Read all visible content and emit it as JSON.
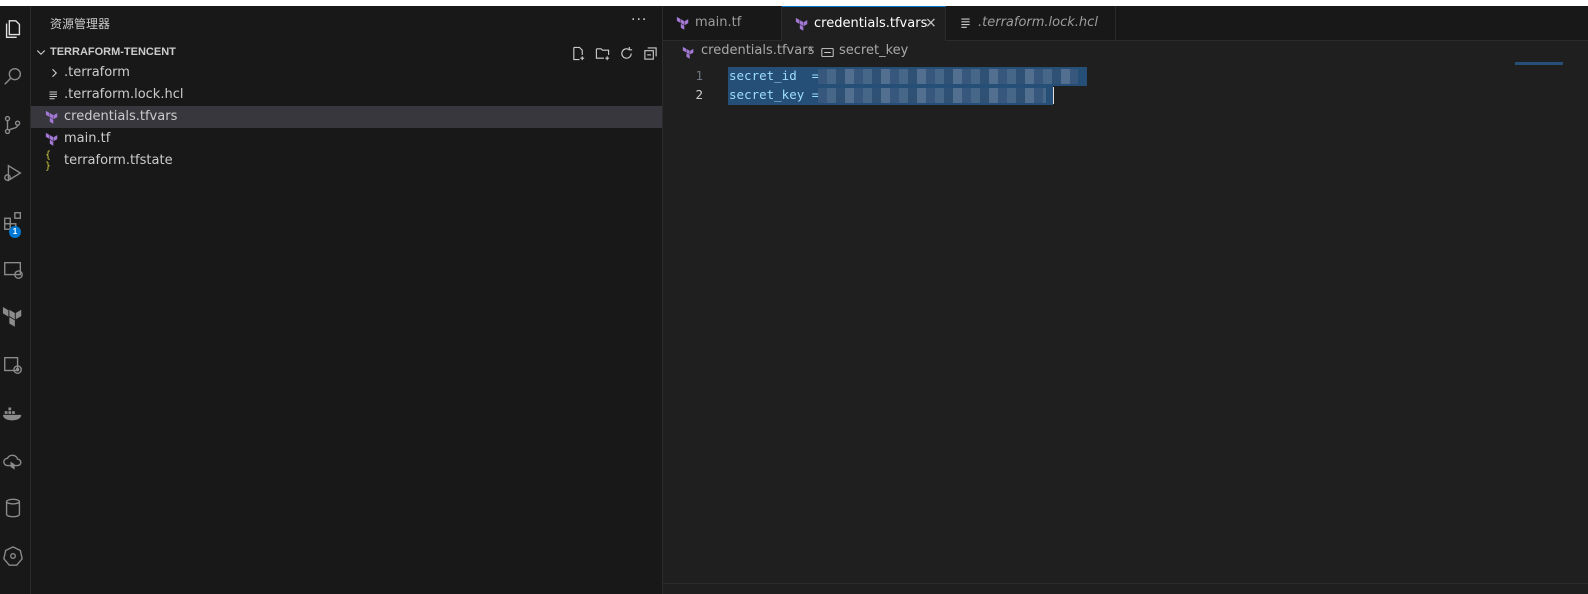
{
  "explorer": {
    "title": "资源管理器",
    "more_label": "···",
    "section_title": "TERRAFORM-TENCENT",
    "tree": [
      {
        "label": ".terraform",
        "icon": "chevron-right-icon"
      },
      {
        "label": ".terraform.lock.hcl",
        "icon": "lines-file-icon"
      },
      {
        "label": "credentials.tfvars",
        "icon": "terraform-icon"
      },
      {
        "label": "main.tf",
        "icon": "terraform-icon"
      },
      {
        "label": "terraform.tfstate",
        "icon": "json-braces-icon"
      }
    ],
    "json_icon_glyph": "{ }"
  },
  "activity": {
    "extensions_badge": "1"
  },
  "tabs": [
    {
      "label": "main.tf",
      "icon": "terraform-icon"
    },
    {
      "label": "credentials.tfvars",
      "icon": "terraform-icon",
      "close": "×"
    },
    {
      "label": ".terraform.lock.hcl",
      "icon": "lines-file-icon"
    }
  ],
  "breadcrumb": {
    "file": "credentials.tfvars",
    "separator": "›",
    "symbol": "secret_key"
  },
  "editor": {
    "lines": [
      {
        "number": "1",
        "text": "secret_id  = "
      },
      {
        "number": "2",
        "text": "secret_key = "
      }
    ]
  },
  "colors": {
    "terraform": "#a479d6",
    "accent": "#0078d4",
    "selection": "#264f78",
    "json_icon": "#cbcb41"
  }
}
